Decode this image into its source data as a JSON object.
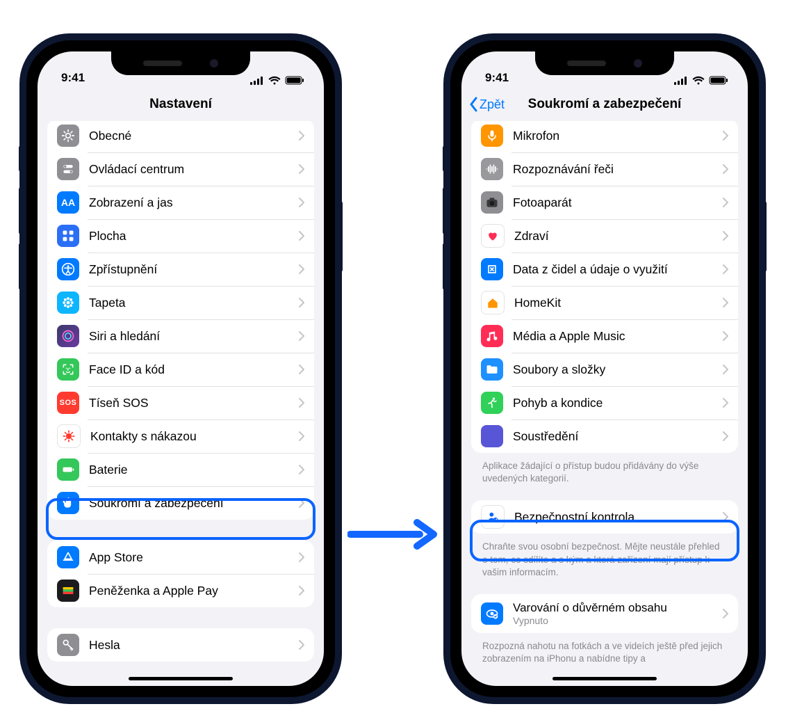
{
  "status": {
    "time": "9:41"
  },
  "left": {
    "title": "Nastavení",
    "group1": [
      {
        "id": "general",
        "label": "Obecné",
        "bg": "bg-gray",
        "glyph": "gear"
      },
      {
        "id": "control-center",
        "label": "Ovládací centrum",
        "bg": "bg-gray",
        "glyph": "switches"
      },
      {
        "id": "display",
        "label": "Zobrazení a jas",
        "bg": "bg-blue",
        "glyph": "AA"
      },
      {
        "id": "home-screen",
        "label": "Plocha",
        "bg": "bg-blue2",
        "glyph": "grid"
      },
      {
        "id": "accessibility",
        "label": "Zpřístupnění",
        "bg": "bg-blue",
        "glyph": "access"
      },
      {
        "id": "wallpaper",
        "label": "Tapeta",
        "bg": "bg-cyan",
        "glyph": "flower"
      },
      {
        "id": "siri",
        "label": "Siri a hledání",
        "bg": "bg-grad1",
        "glyph": "siri"
      },
      {
        "id": "faceid",
        "label": "Face ID a kód",
        "bg": "bg-green",
        "glyph": "faceid"
      },
      {
        "id": "sos",
        "label": "Tíseň SOS",
        "bg": "bg-red",
        "glyph": "SOS"
      },
      {
        "id": "exposure",
        "label": "Kontakty s nákazou",
        "bg": "bg-white",
        "glyph": "virus"
      },
      {
        "id": "battery",
        "label": "Baterie",
        "bg": "bg-green",
        "glyph": "battery"
      },
      {
        "id": "privacy",
        "label": "Soukromí a zabezpečení",
        "bg": "bg-blue",
        "glyph": "hand"
      }
    ],
    "group2": [
      {
        "id": "appstore",
        "label": "App Store",
        "bg": "bg-blue",
        "glyph": "appstore"
      },
      {
        "id": "wallet",
        "label": "Peněženka a Apple Pay",
        "bg": "bg-black",
        "glyph": "wallet"
      }
    ],
    "group3": [
      {
        "id": "passwords",
        "label": "Hesla",
        "bg": "bg-gray",
        "glyph": "key"
      }
    ]
  },
  "right": {
    "back": "Zpět",
    "title": "Soukromí a zabezpečení",
    "group1": [
      {
        "id": "microphone",
        "label": "Mikrofon",
        "bg": "bg-orange",
        "glyph": "mic"
      },
      {
        "id": "speech",
        "label": "Rozpoznávání řeči",
        "bg": "bg-gray2",
        "glyph": "wave"
      },
      {
        "id": "camera",
        "label": "Fotoaparát",
        "bg": "bg-gray",
        "glyph": "camera"
      },
      {
        "id": "health",
        "label": "Zdraví",
        "bg": "bg-white",
        "glyph": "heart"
      },
      {
        "id": "sensor",
        "label": "Data z čidel a údaje o využití",
        "bg": "bg-blue",
        "glyph": "sensor"
      },
      {
        "id": "homekit",
        "label": "HomeKit",
        "bg": "bg-white",
        "glyph": "home"
      },
      {
        "id": "media",
        "label": "Média a Apple Music",
        "bg": "bg-redc",
        "glyph": "music"
      },
      {
        "id": "files",
        "label": "Soubory a složky",
        "bg": "bg-docblue",
        "glyph": "folder"
      },
      {
        "id": "motion",
        "label": "Pohyb a kondice",
        "bg": "bg-green2",
        "glyph": "run"
      },
      {
        "id": "focus",
        "label": "Soustředění",
        "bg": "bg-purple",
        "glyph": "moon"
      }
    ],
    "footer1": "Aplikace žádající o přístup budou přidávány do výše uvedených kategorií.",
    "group2": [
      {
        "id": "safety-check",
        "label": "Bezpečnostní kontrola",
        "bg": "bg-white",
        "glyph": "person"
      }
    ],
    "footer2": "Chraňte svou osobní bezpečnost. Mějte neustále přehled o tom, co sdílíte a s kým a která zařízení mají přístup k vašim informacím.",
    "group3": [
      {
        "id": "sensitive",
        "label": "Varování o důvěrném obsahu",
        "sub": "Vypnuto",
        "bg": "bg-blue",
        "glyph": "eye"
      }
    ],
    "footer3": "Rozpozná nahotu na fotkách a ve videích ještě před jejich zobrazením na iPhonu a nabídne tipy a"
  }
}
